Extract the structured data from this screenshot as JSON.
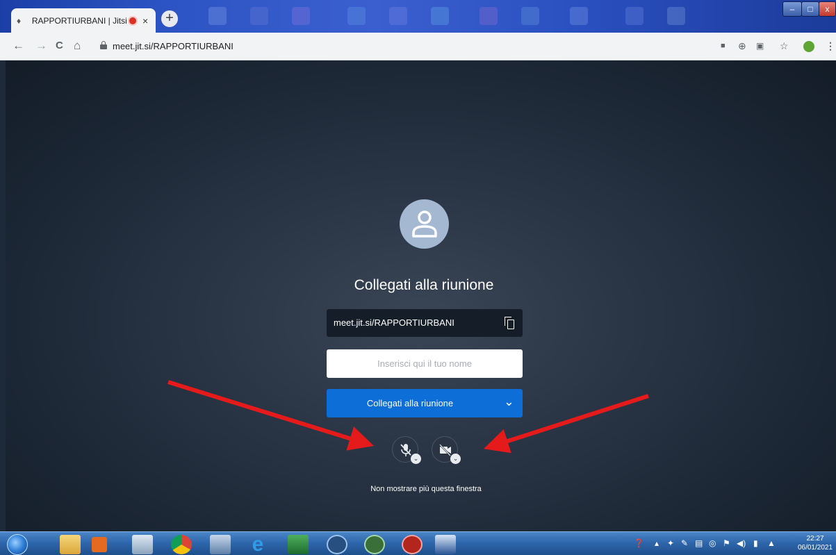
{
  "browser": {
    "tab_title": "RAPPORTIURBANI | Jitsi Mee",
    "tab_close": "×",
    "new_tab": "+",
    "url": "meet.jit.si/RAPPORTIURBANI",
    "window_controls": {
      "minimize": "–",
      "maximize": "□",
      "close": "x"
    },
    "nav": {
      "back": "←",
      "forward": "→",
      "reload": "C",
      "home": "⌂"
    },
    "toolbar_icons": [
      "camera-icon",
      "add-icon",
      "translate-icon",
      "star-icon",
      "extension-leaf-icon",
      "menu-icon"
    ]
  },
  "prejoin": {
    "heading": "Collegati alla riunione",
    "meeting_url": "meet.jit.si/RAPPORTIURBANI",
    "name_placeholder": "Inserisci qui il tuo nome",
    "join_button": "Collegati alla riunione",
    "dont_show": "Non mostrare più questa finestra",
    "mic_state": "muted",
    "camera_state": "off"
  },
  "taskbar": {
    "apps": [
      "explorer-icon",
      "media-player-icon",
      "hp-icon",
      "chrome-icon",
      "paint-icon",
      "internet-explorer-icon",
      "excel-icon",
      "ccleaner-icon",
      "app-v-icon",
      "antivirus-icon",
      "word-icon"
    ],
    "clock_time": "22:27",
    "clock_date": "06/01/2021"
  },
  "colors": {
    "join_button": "#0c6ed6",
    "annotation_arrows": "#e51b1b",
    "avatar": "#a4b8d1"
  }
}
